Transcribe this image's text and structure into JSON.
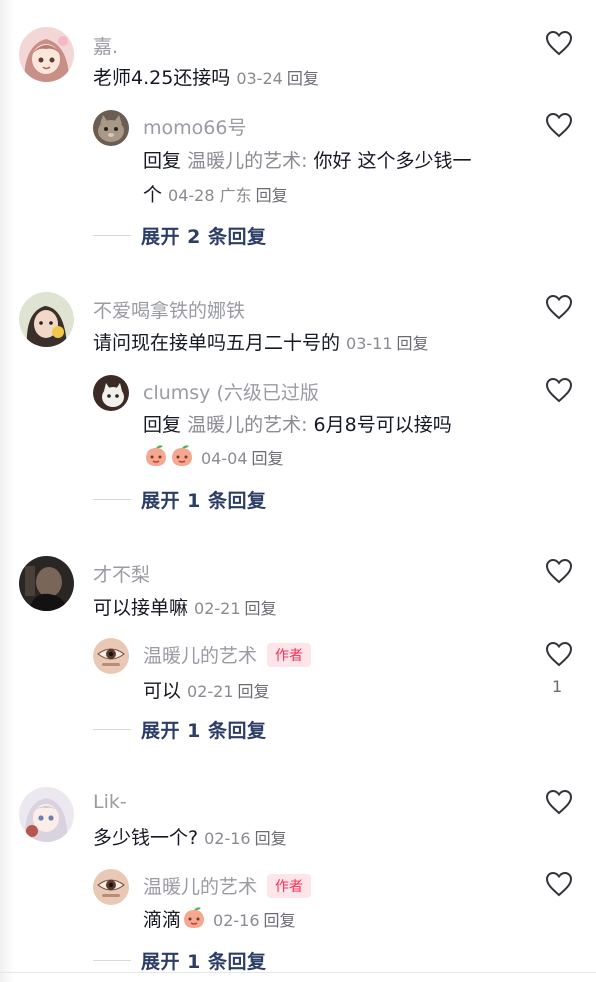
{
  "comments": [
    {
      "user": "嘉.",
      "text": "老师4.25还接吗",
      "date": "03-24",
      "reply_label": "回复",
      "reply": {
        "user": "momo66号",
        "prefix": "回复",
        "to": "温暖儿的艺术:",
        "text1": "你好  这个多少钱一",
        "text2": "个",
        "date": "04-28",
        "location": "广东",
        "reply_label": "回复"
      },
      "expand": "展开 2 条回复"
    },
    {
      "user": "不爱喝拿铁的娜铁",
      "text": "请问现在接单吗五月二十号的",
      "date": "03-11",
      "reply_label": "回复",
      "reply": {
        "user": "clumsy (六级已过版",
        "prefix": "回复",
        "to": "温暖儿的艺术:",
        "text1": "6月8号可以接吗",
        "date": "04-04",
        "reply_label": "回复"
      },
      "expand": "展开 1 条回复"
    },
    {
      "user": "才不梨",
      "text": "可以接单嘛",
      "date": "02-21",
      "reply_label": "回复",
      "reply": {
        "user": "温暖儿的艺术",
        "badge": "作者",
        "text1": "可以",
        "date": "02-21",
        "reply_label": "回复",
        "likes": "1"
      },
      "expand": "展开 1 条回复"
    },
    {
      "user": "Lik-",
      "text": "多少钱一个?",
      "date": "02-16",
      "reply_label": "回复",
      "reply": {
        "user": "温暖儿的艺术",
        "badge": "作者",
        "text1": "滴滴",
        "date": "02-16",
        "reply_label": "回复"
      },
      "expand": "展开 1 条回复"
    }
  ],
  "colors": {
    "text": "#161823",
    "username": "#9a9ba3",
    "meta": "#8a8b91",
    "expand": "#2c3e66",
    "author_badge_bg": "#fde6ea",
    "author_badge_text": "#fe2c55"
  },
  "icons": [
    "heart-outline-icon",
    "peach-emoji-icon"
  ]
}
